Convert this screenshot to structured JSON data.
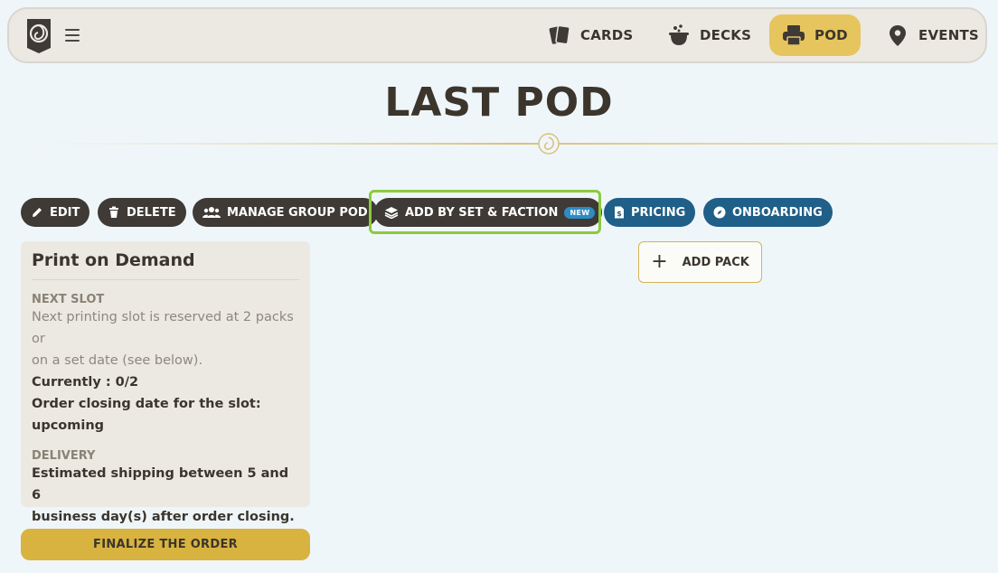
{
  "nav": {
    "items": [
      {
        "label": "CARDS",
        "icon": "cards-icon"
      },
      {
        "label": "DECKS",
        "icon": "cauldron-icon"
      },
      {
        "label": "POD",
        "icon": "printer-icon",
        "active": true
      },
      {
        "label": "EVENTS",
        "icon": "map-pin-icon"
      }
    ],
    "active_color": "#e6c55e"
  },
  "page": {
    "title": "LAST POD"
  },
  "actions": {
    "edit": "EDIT",
    "delete": "DELETE",
    "manage_group": "MANAGE GROUP POD",
    "add_by_set": "ADD BY SET & FACTION",
    "new_badge": "NEW",
    "pricing": "PRICING",
    "onboarding": "ONBOARDING"
  },
  "panel": {
    "title": "Print on Demand",
    "next_slot_label": "NEXT SLOT",
    "next_slot_line1": "Next printing slot is reserved at 2 packs or",
    "next_slot_line2": "on a set date (see below).",
    "currently": "Currently : 0/2",
    "closing_line1": "Order closing date for the slot:",
    "closing_line2": "upcoming",
    "delivery_label": "DELIVERY",
    "delivery_line1": "Estimated shipping between 5 and 6",
    "delivery_line2": "business day(s) after order closing."
  },
  "add_pack": {
    "plus": "+",
    "label": "ADD PACK"
  },
  "finalize": {
    "label": "FINALIZE THE ORDER"
  },
  "colors": {
    "background": "#eff6fa",
    "dark_pill": "#3f3a35",
    "blue_pill": "#1f5f88",
    "highlight": "#8bcb3c",
    "gold": "#d8b33f"
  }
}
